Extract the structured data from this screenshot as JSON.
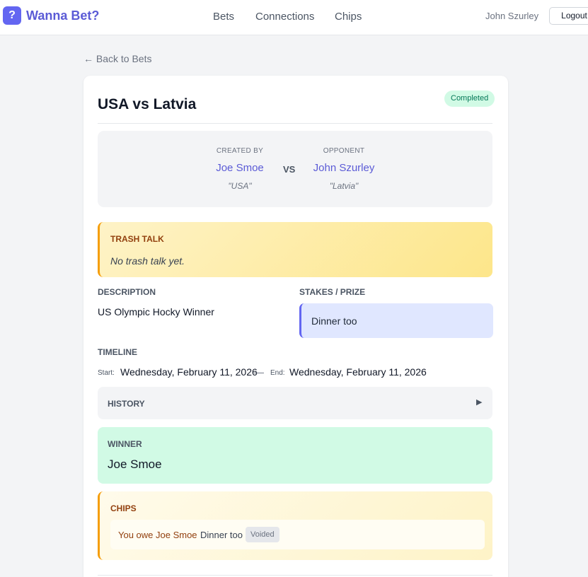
{
  "app": {
    "logo_glyph": "?",
    "brand": "Wanna Bet?",
    "nav": [
      "Bets",
      "Connections",
      "Chips"
    ],
    "user": "John Szurley",
    "logout_label": "Logout"
  },
  "back_link": "← Back to Bets",
  "bet": {
    "title": "USA vs Latvia",
    "status": "Completed",
    "creator": {
      "role": "CREATED BY",
      "name": "Joe Smoe",
      "pick": "\"USA\""
    },
    "vs": "VS",
    "opponent": {
      "role": "OPPONENT",
      "name": "John Szurley",
      "pick": "\"Latvia\""
    },
    "trash_talk": {
      "heading": "TRASH TALK",
      "text": "No trash talk yet."
    },
    "description": {
      "heading": "DESCRIPTION",
      "text": "US Olympic Hocky Winner"
    },
    "stakes": {
      "heading": "STAKES / PRIZE",
      "text": "Dinner too"
    },
    "timeline": {
      "heading": "TIMELINE",
      "start_label": "Start:",
      "start": "Wednesday, February 11, 2026",
      "separator": "—",
      "end_label": "End:",
      "end": "Wednesday, February 11, 2026"
    },
    "history": {
      "heading": "HISTORY",
      "toggle_glyph": "▶"
    },
    "winner": {
      "heading": "WINNER",
      "name": "Joe Smoe"
    },
    "chips": {
      "heading": "CHIPS",
      "owe": "You owe Joe Smoe",
      "stake": "Dinner too",
      "badge": "Voided"
    }
  },
  "colors": {
    "accent": "#6366f1",
    "completed_bg": "#d1fae5",
    "trash_border": "#f59e0b",
    "stakes_bg": "#e0e7ff"
  }
}
